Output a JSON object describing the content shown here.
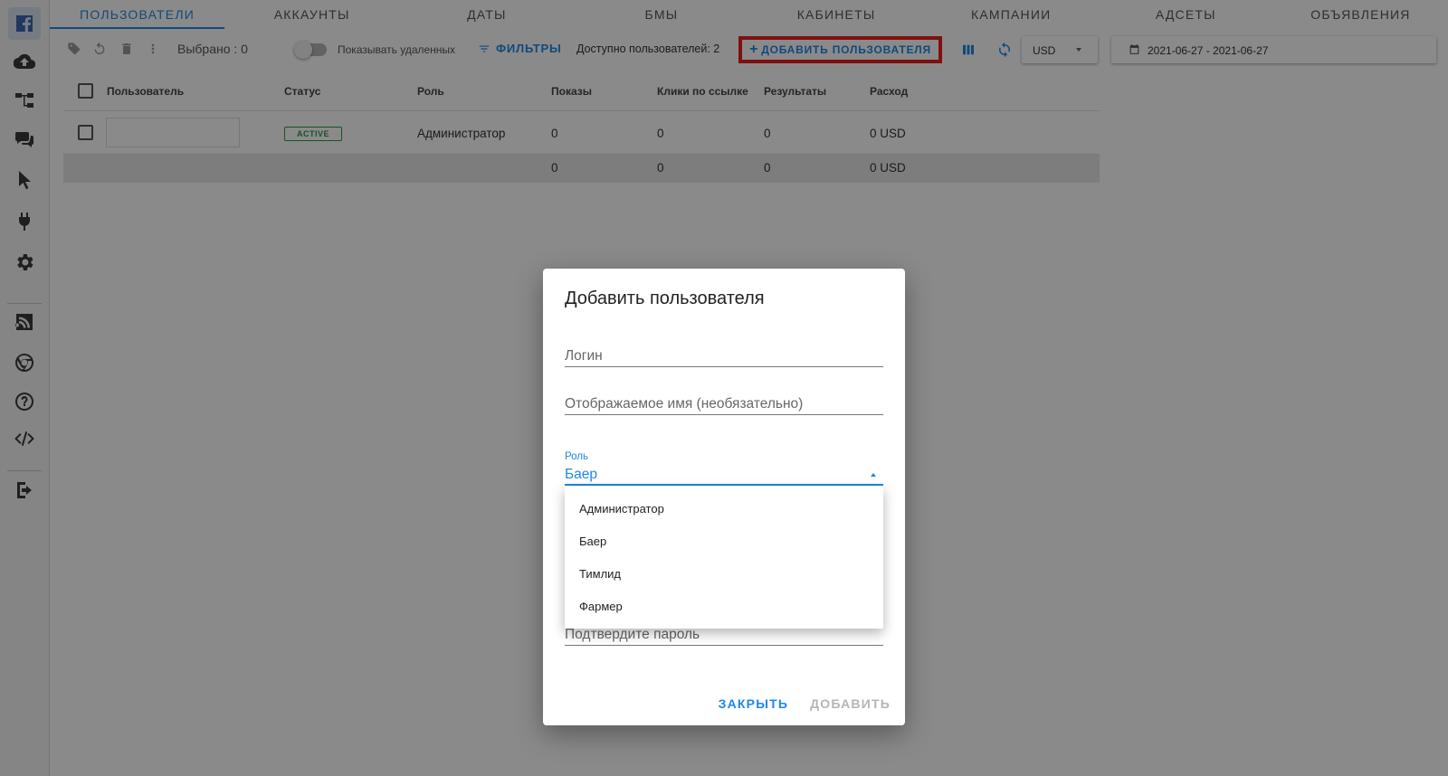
{
  "sidebar": {
    "items": [
      {
        "name": "facebook-icon"
      },
      {
        "name": "cloud-upload-icon"
      },
      {
        "name": "hierarchy-icon"
      },
      {
        "name": "chat-icon"
      },
      {
        "name": "cursor-icon"
      },
      {
        "name": "plug-icon"
      },
      {
        "name": "gear-icon"
      },
      {
        "name": "rss-icon"
      },
      {
        "name": "chrome-icon"
      },
      {
        "name": "help-icon"
      },
      {
        "name": "code-icon"
      },
      {
        "name": "logout-icon"
      }
    ]
  },
  "tabs": [
    "Пользователи",
    "Аккаунты",
    "Даты",
    "БМы",
    "Кабинеты",
    "Кампании",
    "Адсеты",
    "Объявления"
  ],
  "toolbar": {
    "selected": "Выбрано : 0",
    "show_deleted": "Показывать удаленных",
    "filters": "Фильтры",
    "available_users": "Доступно пользователей: 2",
    "add_user": "Добавить пользователя",
    "currency": "USD",
    "date_range": "2021-06-27 - 2021-06-27"
  },
  "table": {
    "headers": [
      "Пользователь",
      "Статус",
      "Роль",
      "Показы",
      "Клики по ссылке",
      "Результаты",
      "Расход"
    ],
    "row": {
      "status": "ACTIVE",
      "role": "Администратор",
      "impressions": "0",
      "clicks": "0",
      "results": "0",
      "spend": "0 USD"
    },
    "totals": {
      "impressions": "0",
      "clicks": "0",
      "results": "0",
      "spend": "0 USD"
    }
  },
  "dialog": {
    "title": "Добавить пользователя",
    "login_placeholder": "Логин",
    "display_name_placeholder": "Отображаемое имя (необязательно)",
    "role_label": "Роль",
    "role_value": "Баер",
    "role_options": [
      "Администратор",
      "Баер",
      "Тимлид",
      "Фармер"
    ],
    "confirm_password_placeholder": "Подтвердите пароль",
    "close_button": "Закрыть",
    "add_button": "Добавить"
  },
  "colors": {
    "accent": "#1e88e5",
    "highlight": "#e8201e",
    "status_active": "#2e9a3e"
  }
}
